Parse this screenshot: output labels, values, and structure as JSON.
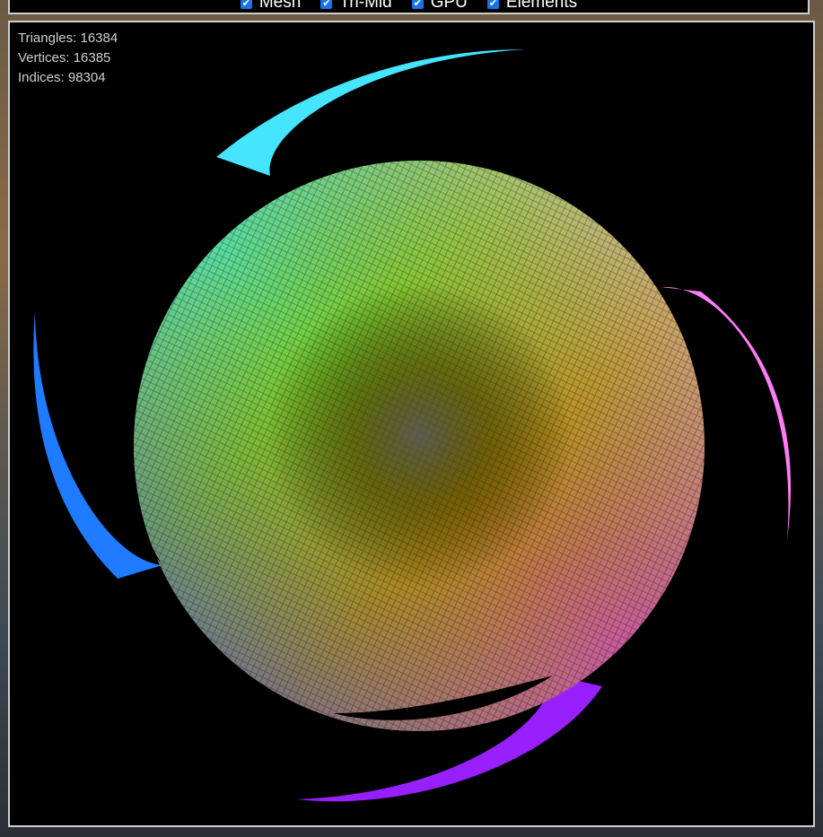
{
  "toolbar": {
    "options": [
      {
        "label": "Mesh",
        "checked": true
      },
      {
        "label": "Tri-Mid",
        "checked": true
      },
      {
        "label": "GPU",
        "checked": true
      },
      {
        "label": "Elements",
        "checked": true
      }
    ]
  },
  "stats": {
    "triangles": "Triangles: 16384",
    "vertices": "Vertices: 16385",
    "indices": "Indices: 98304"
  },
  "colors": {
    "panel_border": "#cfcfcf",
    "checkbox": "#1a73e8",
    "stats_text": "#cfcfcf",
    "cyan": "#3ee6ff",
    "blue": "#1f6bff",
    "violet": "#9b1fff",
    "magenta": "#ff6cf2",
    "olive": "#8a8a10"
  }
}
